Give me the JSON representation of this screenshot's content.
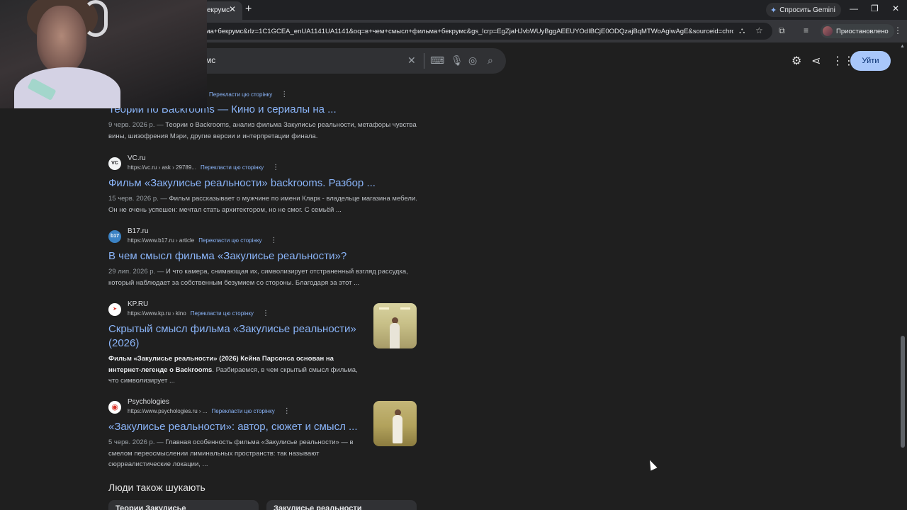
{
  "browser": {
    "tab_title": "екрумс",
    "url": "ма+бекрумс&rlz=1C1GCEA_enUA1141UA1141&oq=в+чем+смысл+фильма+бекрумс&gs_lcrp=EgZjaHJvbWUyBggAEEUYOdIBCjE0ODQzajBqMTWoAgiwAgE&sourceid=chrome...",
    "gemini_label": "Спросить Gemini",
    "profile_label": "Приостановлено"
  },
  "google": {
    "search_query": "мс",
    "login_label": "Уйти"
  },
  "results": [
    {
      "site": "",
      "url": "",
      "translate": "Перекласти цю сторінку",
      "title": "Теории по Backrooms — Кино и сериалы на ...",
      "date": "9 черв. 2026 р. —",
      "snippet": "Теории о Backrooms, анализ фильма Закулисье реальности, метафоры чувства вины, шизофрения Мэри, другие версии и интерпретации финала."
    },
    {
      "site": "VC.ru",
      "url": "https://vc.ru › ask › 29789...",
      "translate": "Перекласти цю сторінку",
      "title": "Фильм «Закулисье реальности» backrooms. Разбор ...",
      "date": "15 черв. 2026 р. —",
      "snippet": "Фильм рассказывает о мужчине по имени Кларк - владельце магазина мебели. Он не очень успешен: мечтал стать архитектором, но не смог. С семьёй ..."
    },
    {
      "site": "B17.ru",
      "url": "https://www.b17.ru › article",
      "translate": "Перекласти цю сторінку",
      "title": "В чем смысл фильма «Закулисье реальности»?",
      "date": "29 лип. 2026 р. —",
      "snippet": "И что камера, снимающая их, символизирует отстраненный взгляд рассудка, который наблюдает за собственным безумием со стороны. Благодаря за этот ..."
    },
    {
      "site": "KP.RU",
      "url": "https://www.kp.ru › kino",
      "translate": "Перекласти цю сторінку",
      "title": "Скрытый смысл фильма «Закулисье реальности» (2026)",
      "date": "",
      "snippet_bold": "Фильм «Закулисье реальности» (2026) Кейна Парсонса основан на интернет-легенде о Backrooms",
      "snippet": ". Разбираемся, в чем скрытый смысл фильма, что символизирует ..."
    },
    {
      "site": "Psychologies",
      "url": "https://www.psychologies.ru › ...",
      "translate": "Перекласти цю сторінку",
      "title": "«Закулисье реальности»: автор, сюжет и смысл ...",
      "date": "5 черв. 2026 р. —",
      "snippet": "Главная особенность фильма «Закулисье реальности» — в смелом переосмыслении лиминальных пространств: так называют сюрреалистические локации, ..."
    }
  ],
  "people_also_search": {
    "title": "Люди також шукають",
    "chips": [
      "Теории Закулисье",
      "Закулисье реальности"
    ]
  },
  "icons": [
    "gemini-star-icon",
    "minimize-icon",
    "maximize-icon",
    "close-icon",
    "translate-icon",
    "star-icon",
    "extensions-icon",
    "settings-icon",
    "share-icon",
    "apps-icon",
    "keyboard-icon",
    "mic-icon",
    "lens-icon",
    "search-icon"
  ]
}
